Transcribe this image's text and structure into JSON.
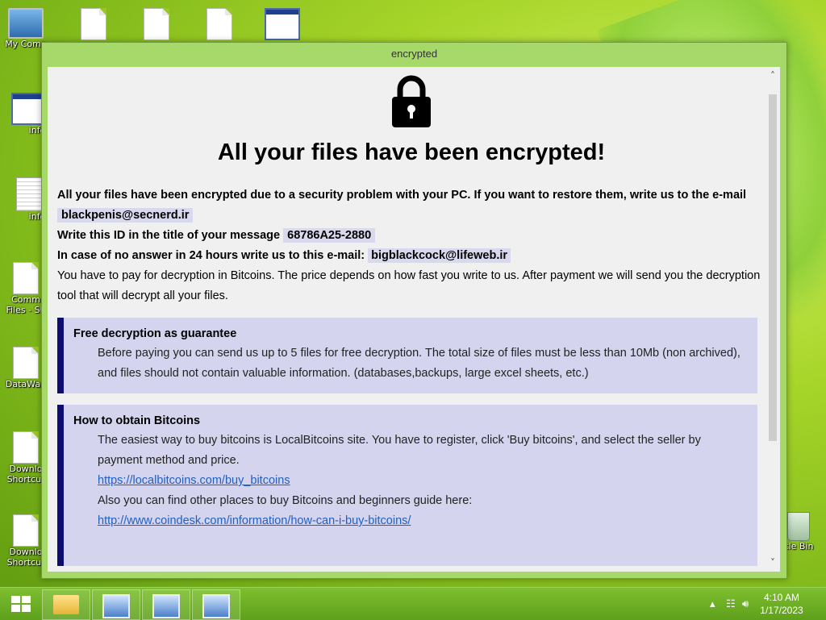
{
  "desktop": {
    "icons": [
      {
        "label": "My Comp",
        "icon": "computer-icon"
      },
      {
        "label": "info",
        "icon": "window-icon"
      },
      {
        "label": "info",
        "icon": "text-file-icon"
      },
      {
        "label": "Comm Files - Sh",
        "icon": "file-icon"
      },
      {
        "label": "DataWag",
        "icon": "file-icon"
      },
      {
        "label": "Downlo Shortcut",
        "icon": "file-icon"
      },
      {
        "label": "Downlo Shortcut",
        "icon": "file-icon"
      },
      {
        "label": "cle Bin",
        "icon": "recycle-bin-icon"
      }
    ]
  },
  "window": {
    "title": "encrypted",
    "headline": "All your files have been encrypted!",
    "para1_text": "All your files have been encrypted due to a security problem with your PC. If you want to restore them, write us to the e-mail",
    "email1": "blackpenis@secnerd.ir",
    "id_text": "Write this ID in the title of your message",
    "id_value": "68786A25-2880",
    "noanswer_text": "In case of no answer in 24 hours write us to this e-mail:",
    "email2": "bigblackcock@lifeweb.ir",
    "pay_text": "You have to pay for decryption in Bitcoins. The price depends on how fast you write to us. After payment we will send you the decryption tool that will decrypt all your files.",
    "box1": {
      "title": "Free decryption as guarantee",
      "body": "Before paying you can send us up to 5 files for free decryption. The total size of files must be less than 10Mb (non archived), and files should not contain valuable information. (databases,backups, large excel sheets, etc.)"
    },
    "box2": {
      "title": "How to obtain Bitcoins",
      "body1": "The easiest way to buy bitcoins is LocalBitcoins site. You have to register, click 'Buy bitcoins', and select the seller by payment method and price.",
      "link1": "https://localbitcoins.com/buy_bitcoins",
      "body2": "Also you can find other places to buy Bitcoins and beginners guide here:",
      "link2": "http://www.coindesk.com/information/how-can-i-buy-bitcoins/"
    }
  },
  "taskbar": {
    "time": "4:10 AM",
    "date": "1/17/2023",
    "buttons": [
      "file-explorer-icon",
      "app-icon",
      "app-icon",
      "app-icon"
    ]
  }
}
